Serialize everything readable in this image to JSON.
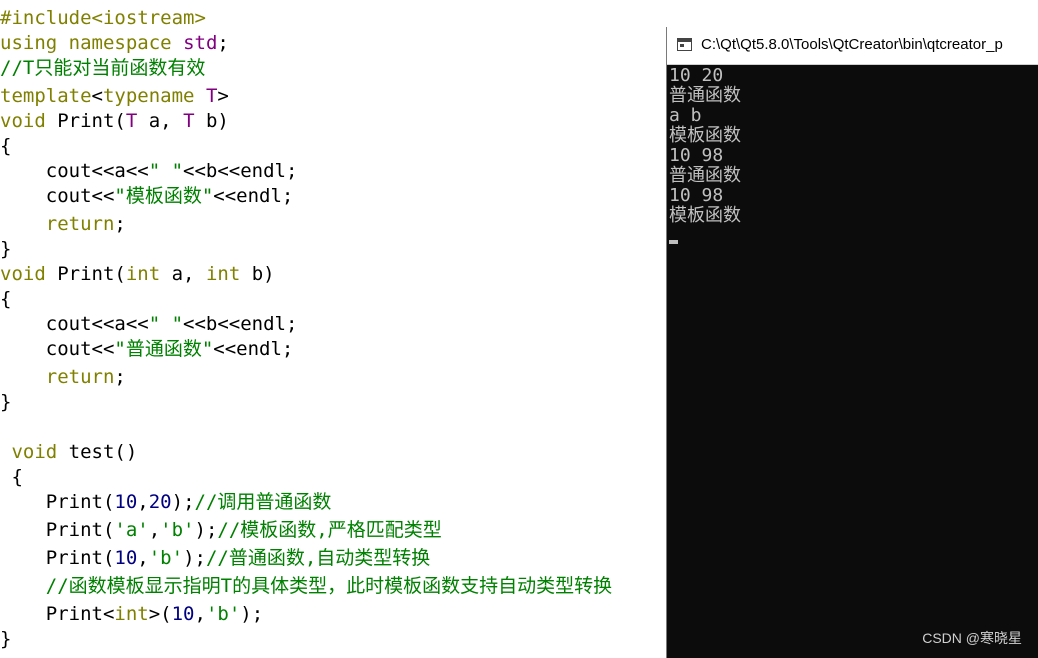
{
  "editor": {
    "lines": [
      [
        "#include",
        "<iostream>"
      ],
      [
        "using",
        " ",
        "namespace",
        " ",
        "std",
        ";"
      ],
      [
        "//T只能对当前函数有效"
      ],
      [
        "template",
        "<",
        "typename",
        " ",
        "T",
        ">"
      ],
      [
        "void",
        " Print(",
        "T",
        " a, ",
        "T",
        " b)"
      ],
      [
        "{"
      ],
      [
        "    cout<<a<<",
        "\" \"",
        "<<b<<endl;"
      ],
      [
        "    cout<<",
        "\"模板函数\"",
        "<<endl;"
      ],
      [
        "    ",
        "return",
        ";"
      ],
      [
        "}"
      ],
      [
        "void",
        " Print(",
        "int",
        " a, ",
        "int",
        " b)"
      ],
      [
        "{"
      ],
      [
        "    cout<<a<<",
        "\" \"",
        "<<b<<endl;"
      ],
      [
        "    cout<<",
        "\"普通函数\"",
        "<<endl;"
      ],
      [
        "    ",
        "return",
        ";"
      ],
      [
        "}"
      ],
      [
        " ",
        "void",
        " test()"
      ],
      [
        " {"
      ],
      [
        "    Print(",
        "10",
        ",",
        "20",
        ");",
        "//调用普通函数"
      ],
      [
        "    Print(",
        "'a'",
        ",",
        "'b'",
        ");",
        "//模板函数,严格匹配类型"
      ],
      [
        "    Print(",
        "10",
        ",",
        "'b'",
        ");",
        "//普通函数,自动类型转换"
      ],
      [
        "    ",
        "//函数模板显示指明T的具体类型，此时模板函数支持自动类型转换"
      ],
      [
        "    Print<",
        "int",
        ">(",
        "10",
        ",",
        "'b'",
        ");"
      ],
      [
        "}"
      ]
    ]
  },
  "console": {
    "title": "C:\\Qt\\Qt5.8.0\\Tools\\QtCreator\\bin\\qtcreator_p",
    "output": [
      "10 20",
      "普通函数",
      "a b",
      "模板函数",
      "10 98",
      "普通函数",
      "10 98",
      "模板函数"
    ]
  },
  "watermark": "CSDN @寒晓星"
}
